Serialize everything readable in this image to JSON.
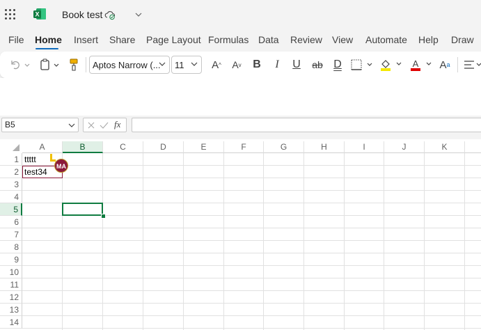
{
  "title_bar": {
    "book_title": "Book test",
    "app_icon": "excel-icon",
    "app_letter": "X"
  },
  "menu": {
    "tabs": [
      "File",
      "Home",
      "Insert",
      "Share",
      "Page Layout",
      "Formulas",
      "Data",
      "Review",
      "View",
      "Automate",
      "Help",
      "Draw"
    ],
    "active": "Home"
  },
  "ribbon": {
    "font_name": "Aptos Narrow (...",
    "font_size": "11",
    "bold": "B",
    "italic": "I",
    "underline": "U",
    "strike": "ab",
    "double_underline": "D",
    "grow_font": "A",
    "shrink_font": "A",
    "font_color_letter": "A",
    "superscript_letter": "A",
    "superscript_mark": "a",
    "colors": {
      "highlight": "#f5e800",
      "font_color": "#e00000"
    }
  },
  "formula_bar": {
    "name_box": "B5",
    "fx_label": "fx",
    "formula": ""
  },
  "grid": {
    "columns": [
      "A",
      "B",
      "C",
      "D",
      "E",
      "F",
      "G",
      "H",
      "I",
      "J",
      "K"
    ],
    "rows": [
      "1",
      "2",
      "3",
      "4",
      "5",
      "6",
      "7",
      "8",
      "9",
      "10",
      "11",
      "12",
      "13",
      "14"
    ],
    "selected_cell": "B5",
    "cells": {
      "A1": "ttttt",
      "A2": "test34"
    },
    "presence_initials": "MA",
    "colors": {
      "selection": "#107c41",
      "presence": "#8b1a3a"
    }
  }
}
